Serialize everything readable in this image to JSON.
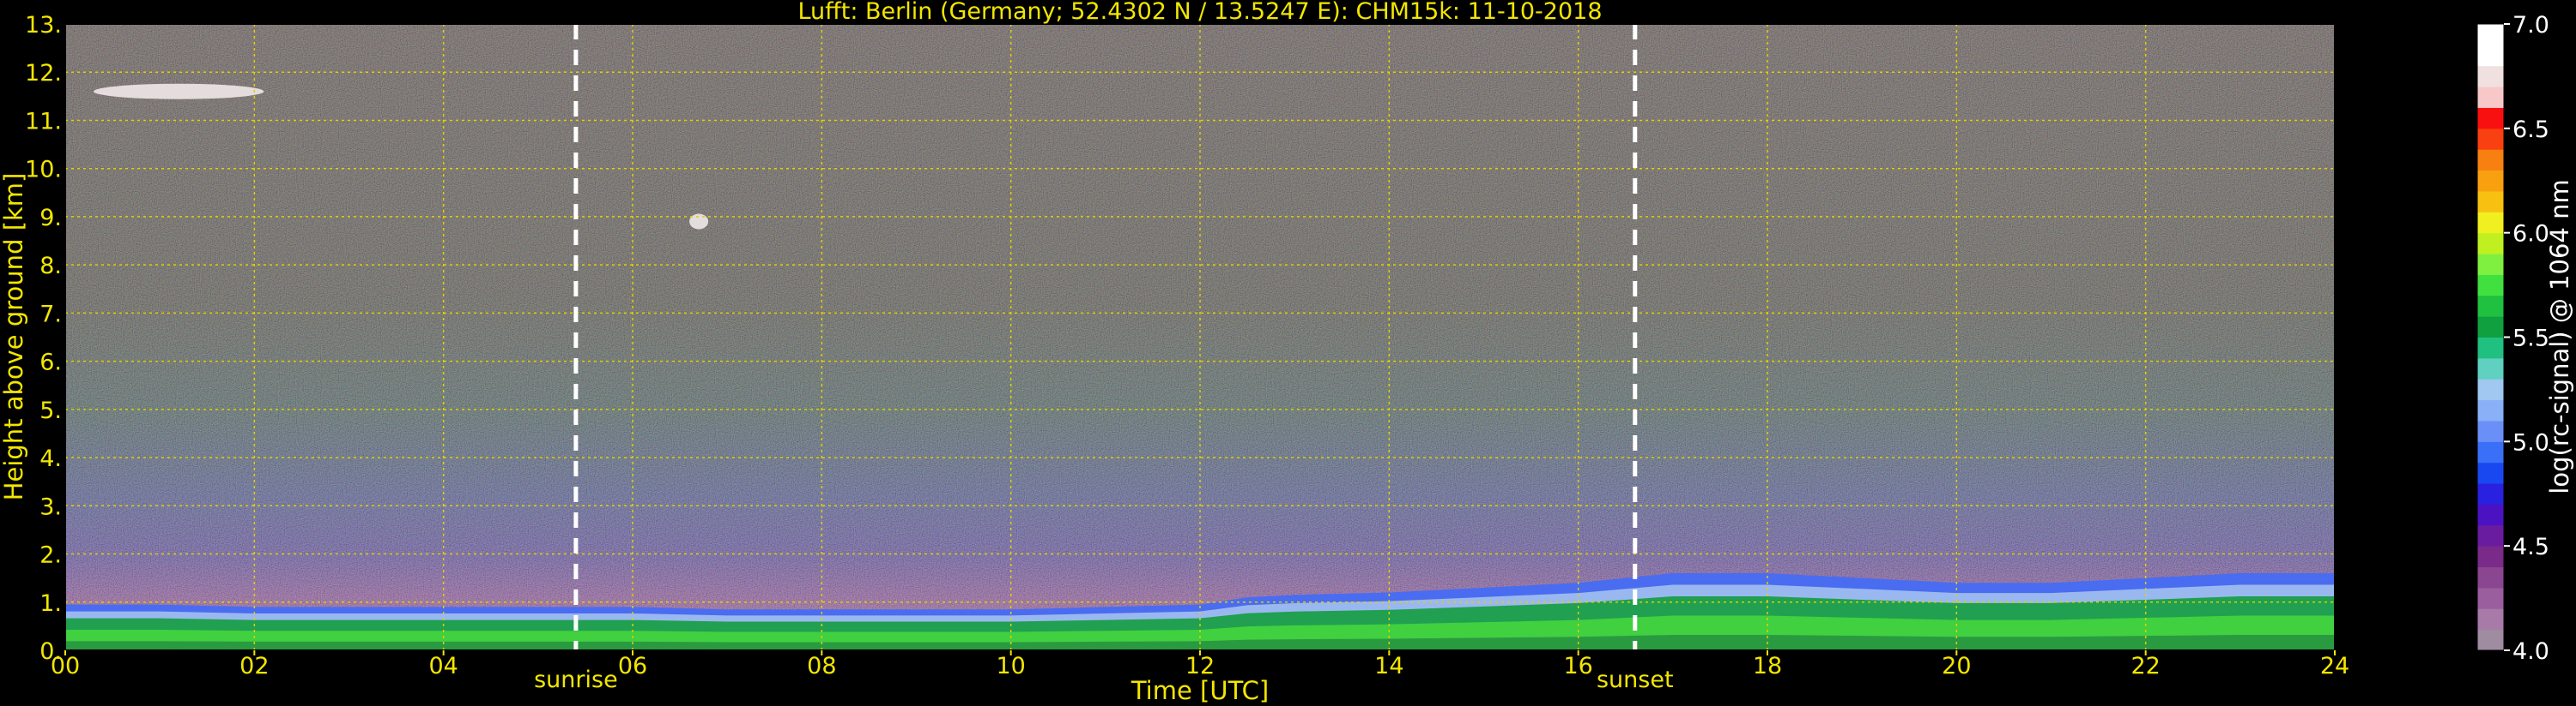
{
  "chart_data": {
    "type": "heatmap",
    "title": "Lufft: Berlin (Germany; 52.4302 N / 13.5247 E):    CHM15k: 11-10-2018",
    "xlabel": "Time [UTC]",
    "ylabel": "Height above ground [km]",
    "xlim": [
      0,
      24
    ],
    "ylim": [
      0,
      13
    ],
    "x_ticks": [
      "00",
      "02",
      "04",
      "06",
      "08",
      "10",
      "12",
      "14",
      "16",
      "18",
      "20",
      "22",
      "24"
    ],
    "y_ticks": [
      "0.",
      "1.",
      "2.",
      "3.",
      "4.",
      "5.",
      "6.",
      "7.",
      "8.",
      "9.",
      "10.",
      "11.",
      "12.",
      "13."
    ],
    "grid": true,
    "colorbar": {
      "label": "log(rc-signal) @ 1064 nm",
      "range": [
        4.0,
        7.0
      ],
      "ticks": [
        "4.0",
        "4.5",
        "5.0",
        "5.5",
        "6.0",
        "6.5",
        "7.0"
      ],
      "bands": [
        "#a08ca0",
        "#a87aa8",
        "#9a5e9e",
        "#8a4690",
        "#7a2a88",
        "#6a1ca0",
        "#4a12c0",
        "#2a20e0",
        "#1a48f0",
        "#3a70f8",
        "#6a90f8",
        "#8ab0f8",
        "#a0c8f0",
        "#60d0c0",
        "#20c080",
        "#10a040",
        "#20c040",
        "#40e040",
        "#80f040",
        "#c0f020",
        "#f0f020",
        "#f8c010",
        "#f8a010",
        "#f88010",
        "#f84010",
        "#f81010",
        "#f8c8c8",
        "#f0e0e0",
        "#ffffff",
        "#ffffff"
      ]
    },
    "boundary_layer_top_km": [
      [
        0,
        0.95
      ],
      [
        1,
        0.95
      ],
      [
        2,
        0.9
      ],
      [
        3,
        0.9
      ],
      [
        4,
        0.9
      ],
      [
        5,
        0.9
      ],
      [
        6,
        0.9
      ],
      [
        7,
        0.85
      ],
      [
        8,
        0.85
      ],
      [
        9,
        0.85
      ],
      [
        10,
        0.85
      ],
      [
        11,
        0.9
      ],
      [
        12,
        0.95
      ],
      [
        12.5,
        1.1
      ],
      [
        13,
        1.15
      ],
      [
        14,
        1.2
      ],
      [
        15,
        1.3
      ],
      [
        16,
        1.4
      ],
      [
        17,
        1.6
      ],
      [
        18,
        1.6
      ],
      [
        19,
        1.5
      ],
      [
        20,
        1.4
      ],
      [
        21,
        1.4
      ],
      [
        22,
        1.5
      ],
      [
        23,
        1.6
      ],
      [
        24,
        1.6
      ]
    ],
    "clouds": [
      {
        "x_start": 0.3,
        "x_end": 2.1,
        "height_km": 11.6
      },
      {
        "x_start": 6.6,
        "x_end": 6.8,
        "height_km": 8.9
      }
    ],
    "events": [
      {
        "label": "sunrise",
        "time": 5.4
      },
      {
        "label": "sunset",
        "time": 16.6
      }
    ]
  }
}
